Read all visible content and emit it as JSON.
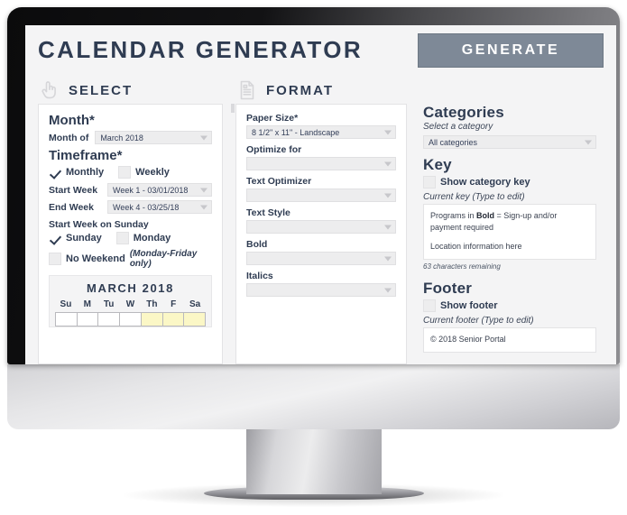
{
  "header": {
    "title": "CALENDAR GENERATOR",
    "generate_label": "GENERATE"
  },
  "sections": {
    "select": {
      "label": "SELECT",
      "icon": "pointing-hand-icon"
    },
    "format": {
      "label": "FORMAT",
      "icon": "document-icon"
    }
  },
  "select_panel": {
    "month_group_title": "Month*",
    "month_of_label": "Month of",
    "month_of_value": "March 2018",
    "timeframe_group_title": "Timeframe*",
    "monthly_label": "Monthly",
    "monthly_checked": true,
    "weekly_label": "Weekly",
    "weekly_checked": false,
    "start_week_label": "Start Week",
    "start_week_value": "Week 1 - 03/01/2018",
    "end_week_label": "End Week",
    "end_week_value": "Week 4 - 03/25/18",
    "start_on_sunday_label": "Start Week on Sunday",
    "sunday_label": "Sunday",
    "sunday_checked": true,
    "monday_label": "Monday",
    "monday_checked": false,
    "no_weekend_label": "No Weekend",
    "no_weekend_note": "(Monday-Friday only)",
    "no_weekend_checked": false,
    "calendar": {
      "month_title": "MARCH 2018",
      "dow": [
        "Su",
        "M",
        "Tu",
        "W",
        "Th",
        "F",
        "Sa"
      ],
      "highlighted_days": [
        "Th",
        "F",
        "Sa"
      ],
      "highlight_color": "#fbf7c6"
    }
  },
  "format_panel": {
    "paper_size_label": "Paper Size*",
    "paper_size_value": "8 1/2\" x 11\" - Landscape",
    "optimize_for_label": "Optimize for",
    "optimize_for_value": "",
    "text_optimizer_label": "Text Optimizer",
    "text_optimizer_value": "",
    "text_style_label": "Text Style",
    "text_style_value": "",
    "bold_label": "Bold",
    "bold_value": "",
    "italics_label": "Italics",
    "italics_value": ""
  },
  "categories_panel": {
    "categories_title": "Categories",
    "select_category_note": "Select a category",
    "category_value": "All categories",
    "key_title": "Key",
    "show_key_label": "Show category key",
    "show_key_checked": false,
    "current_key_label": "Current key (Type to edit)",
    "key_line1_pre": "Programs in ",
    "key_line1_bold": "Bold",
    "key_line1_post": " = Sign-up and/or payment required",
    "key_line2": "Location information here",
    "chars_remaining": "63 characters remaining",
    "footer_title": "Footer",
    "show_footer_label": "Show footer",
    "show_footer_checked": false,
    "current_footer_label": "Current footer (Type to edit)",
    "footer_value": "© 2018 Senior Portal"
  },
  "colors": {
    "ink": "#2f3c52",
    "generate_button": "#7e8997",
    "page_bg": "#f4f4f5",
    "highlight": "#fbf7c6"
  }
}
